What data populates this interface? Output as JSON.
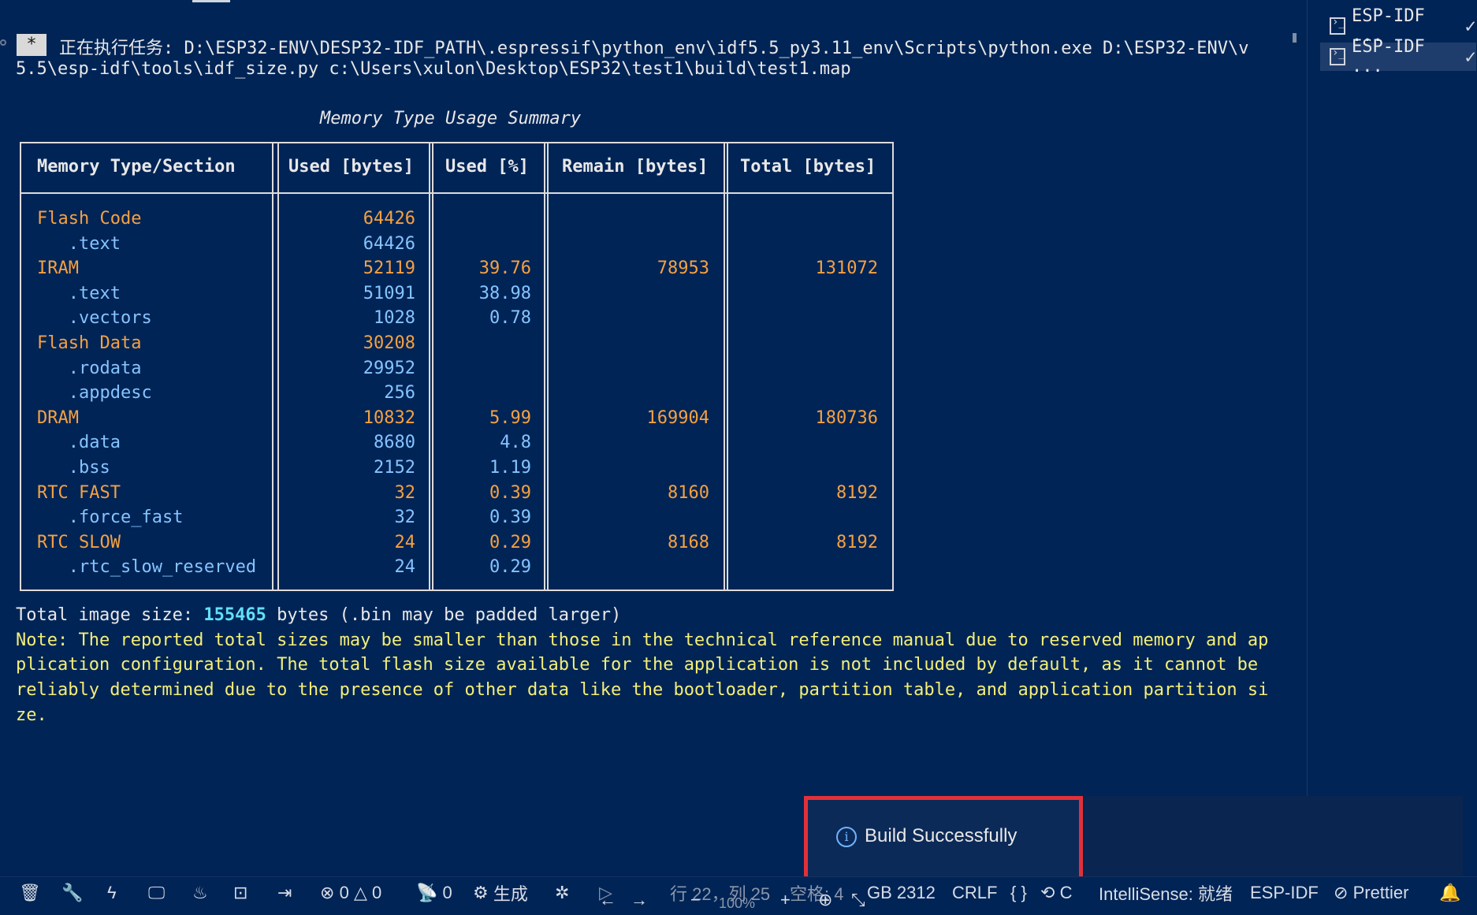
{
  "task": {
    "badge": "*",
    "line1": "正在执行任务: D:\\ESP32-ENV\\DESP32-IDF_PATH\\.espressif\\python_env\\idf5.5_py3.11_env\\Scripts\\python.exe D:\\ESP32-ENV\\v",
    "line2": "5.5\\esp-idf\\tools\\idf_size.py c:\\Users\\xulon\\Desktop\\ESP32\\test1\\build\\test1.map"
  },
  "summary_title": "Memory Type Usage Summary",
  "table": {
    "headers": [
      "Memory Type/Section",
      "Used [bytes]",
      "Used [%]",
      "Remain [bytes]",
      "Total [bytes]"
    ],
    "rows": [
      {
        "name": "Flash Code",
        "used": "64426",
        "pct": "",
        "remain": "",
        "total": "",
        "kind": "section"
      },
      {
        "name": "   .text",
        "used": "64426",
        "pct": "",
        "remain": "",
        "total": "",
        "kind": "sub"
      },
      {
        "name": "IRAM",
        "used": "52119",
        "pct": "39.76",
        "remain": "78953",
        "total": "131072",
        "kind": "section"
      },
      {
        "name": "   .text",
        "used": "51091",
        "pct": "38.98",
        "remain": "",
        "total": "",
        "kind": "sub"
      },
      {
        "name": "   .vectors",
        "used": "1028",
        "pct": "0.78",
        "remain": "",
        "total": "",
        "kind": "sub"
      },
      {
        "name": "Flash Data",
        "used": "30208",
        "pct": "",
        "remain": "",
        "total": "",
        "kind": "section"
      },
      {
        "name": "   .rodata",
        "used": "29952",
        "pct": "",
        "remain": "",
        "total": "",
        "kind": "sub"
      },
      {
        "name": "   .appdesc",
        "used": "256",
        "pct": "",
        "remain": "",
        "total": "",
        "kind": "sub"
      },
      {
        "name": "DRAM",
        "used": "10832",
        "pct": "5.99",
        "remain": "169904",
        "total": "180736",
        "kind": "section"
      },
      {
        "name": "   .data",
        "used": "8680",
        "pct": "4.8",
        "remain": "",
        "total": "",
        "kind": "sub"
      },
      {
        "name": "   .bss",
        "used": "2152",
        "pct": "1.19",
        "remain": "",
        "total": "",
        "kind": "sub"
      },
      {
        "name": "RTC FAST",
        "used": "32",
        "pct": "0.39",
        "remain": "8160",
        "total": "8192",
        "kind": "section"
      },
      {
        "name": "   .force_fast",
        "used": "32",
        "pct": "0.39",
        "remain": "",
        "total": "",
        "kind": "sub"
      },
      {
        "name": "RTC SLOW",
        "used": "24",
        "pct": "0.29",
        "remain": "8168",
        "total": "8192",
        "kind": "section"
      },
      {
        "name": "   .rtc_slow_reserved",
        "used": "24",
        "pct": "0.29",
        "remain": "",
        "total": "",
        "kind": "sub"
      }
    ]
  },
  "total_image": {
    "prefix": "Total image size: ",
    "value": "155465",
    "suffix": " bytes (.bin may be padded larger)"
  },
  "note_lines": [
    "Note: The reported total sizes may be smaller than those in the technical reference manual due to reserved memory and ap",
    "plication configuration. The total flash size available for the application is not included by default, as it cannot be",
    "reliably determined due to the presence of other data like the bootloader, partition table, and application partition si",
    "ze."
  ],
  "terminal_tabs": [
    {
      "label": "ESP-IDF ...",
      "icon": "terminal-icon",
      "status_icon": "check-icon"
    },
    {
      "label": "ESP-IDF ...",
      "icon": "terminal-icon",
      "status_icon": "check-icon"
    }
  ],
  "toast": {
    "icon": "info-icon",
    "message": "Build Successfully"
  },
  "statusbar": {
    "errors": "0",
    "warnings": "0",
    "ports": "0",
    "build_label": "生成",
    "position": "行 22，列 25",
    "zoom": "100%",
    "spaces": "空格: 4",
    "encoding": "GB 2312",
    "eol": "CRLF",
    "lang": "C",
    "intellisense": "IntelliSense: 就绪",
    "espidf": "ESP-IDF",
    "prettier": "Prettier"
  },
  "colors": {
    "background": "#012456",
    "section": "#f5a142",
    "subsection": "#86c4ff",
    "note": "#f3ef78",
    "highlight": "#62e0f5",
    "toast_border": "#e2303a"
  }
}
